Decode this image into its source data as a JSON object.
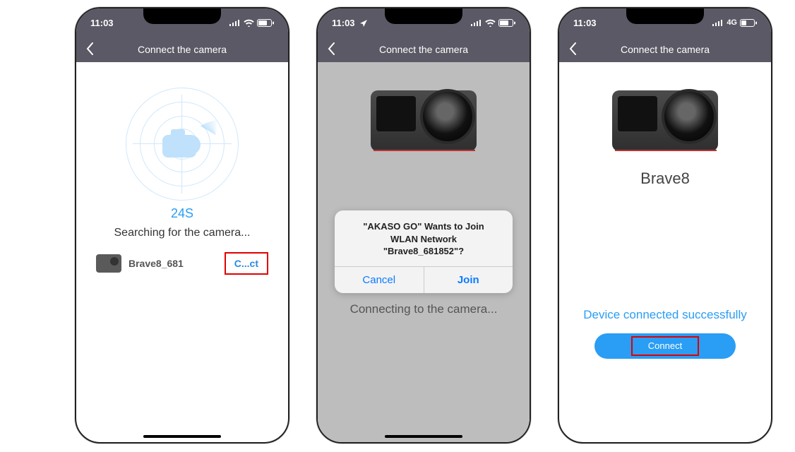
{
  "status": {
    "time": "11:03",
    "net_label_4g": "4G"
  },
  "nav": {
    "title": "Connect the camera"
  },
  "screen1": {
    "countdown": "24S",
    "searching": "Searching for the camera...",
    "device_name": "Brave8_681",
    "connect_label": "C...ct"
  },
  "screen2": {
    "alert_line1": "\"AKASO GO\" Wants to Join",
    "alert_line2": "WLAN Network",
    "alert_line3": "\"Brave8_681852\"?",
    "cancel": "Cancel",
    "join": "Join",
    "connecting": "Connecting to the camera..."
  },
  "screen3": {
    "device_title": "Brave8",
    "success": "Device connected successfully",
    "connect_btn": "Connect"
  }
}
